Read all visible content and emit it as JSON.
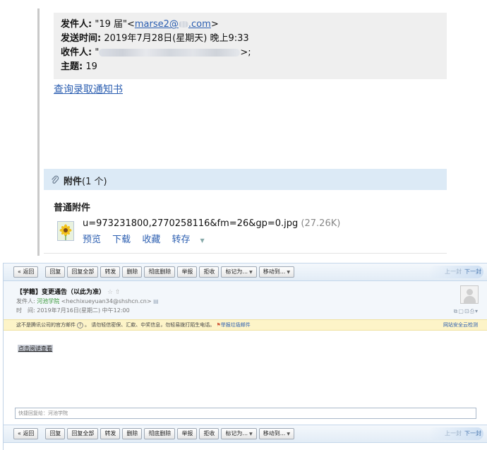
{
  "top": {
    "from_label": "发件人:",
    "from_name": " \"19 届\"<",
    "from_email_visible_start": "marse2@",
    "from_email_visible_end": ".com",
    "from_close": ">",
    "sent_label": "发送时间:",
    "sent_value": " 2019年7月28日(星期天) 晚上9:33",
    "to_label": "收件人:",
    "to_prefix": " \"",
    "to_suffix": ">;",
    "subject_label": "主题:",
    "subject_value": " 19",
    "query_link": "查询录取通知书",
    "attachment_title": "附件",
    "attachment_count": "(1 个)",
    "normal_attachment_label": "普通附件",
    "file_name": "u=973231800,2770258116&fm=26&gp=0.jpg",
    "file_size": "(27.26K)",
    "actions": {
      "preview": "预览",
      "download": "下载",
      "favorite": "收藏",
      "forward": "转存"
    }
  },
  "toolbar": {
    "back": "« 返回",
    "reply": "回复",
    "reply_all": "回复全部",
    "forward": "转发",
    "delete": "删除",
    "perm_delete": "彻底删除",
    "report": "举报",
    "reject": "拒收",
    "mark_as": "标记为...",
    "move_to": "移动到...",
    "prev": "上一封",
    "next": "下一封"
  },
  "mail": {
    "subject": "【学籍】变更通告（以此为准）",
    "star": "☆ ⇧",
    "from_label": "发件人: ",
    "from_name": "河池学院",
    "from_email": " <hechixueyuan34@shshcn.cn> ",
    "time_label": "时　间: ",
    "time_value": "2019年7月16日(星期二) 中午12:00",
    "notice": "这不是腾讯公司的官方邮件",
    "notice_rest": "。 请勿轻信密保、汇款、中奖信息，勿轻易拨打陌生电话。",
    "report_spam": "举报垃圾邮件",
    "security_check": "网站安全云检测",
    "read_link": "点击阅读查看",
    "quick_reply_placeholder": "快捷回复给：河池学院"
  },
  "colors": {
    "link": "#2a5db0",
    "attachment_bar": "#dceaf6",
    "notice_bg": "#fdf4c8",
    "header_bg": "#efefef"
  }
}
